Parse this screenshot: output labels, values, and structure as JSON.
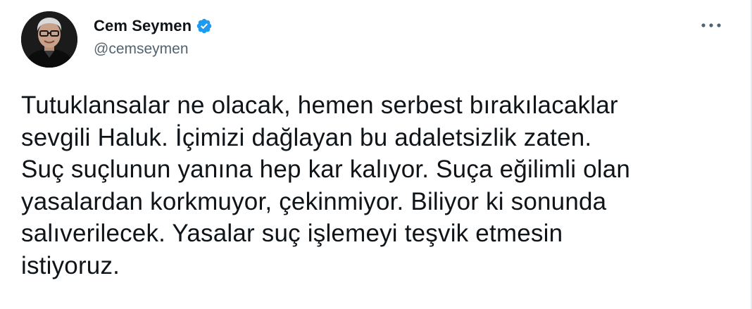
{
  "author": {
    "display_name": "Cem Seymen",
    "handle": "@cemseymen",
    "verified": true,
    "avatar_icon": "profile-photo"
  },
  "menu": {
    "icon": "more-horizontal-icon"
  },
  "tweet": {
    "lines": [
      "Tutuklansalar ne olacak, hemen serbest bırakılacaklar",
      "sevgili Haluk. İçimizi dağlayan bu adaletsizlik zaten.",
      "Suç suçlunun yanına hep kar kalıyor. Suça eğilimli olan",
      "yasalardan korkmuyor, çekinmiyor. Biliyor ki sonunda",
      "salıverilecek. Yasalar suç işlemeyi teşvik etmesin",
      "istiyoruz."
    ]
  },
  "colors": {
    "verified_badge": "#1d9bf0",
    "text_primary": "#0f1419",
    "text_secondary": "#536471"
  }
}
